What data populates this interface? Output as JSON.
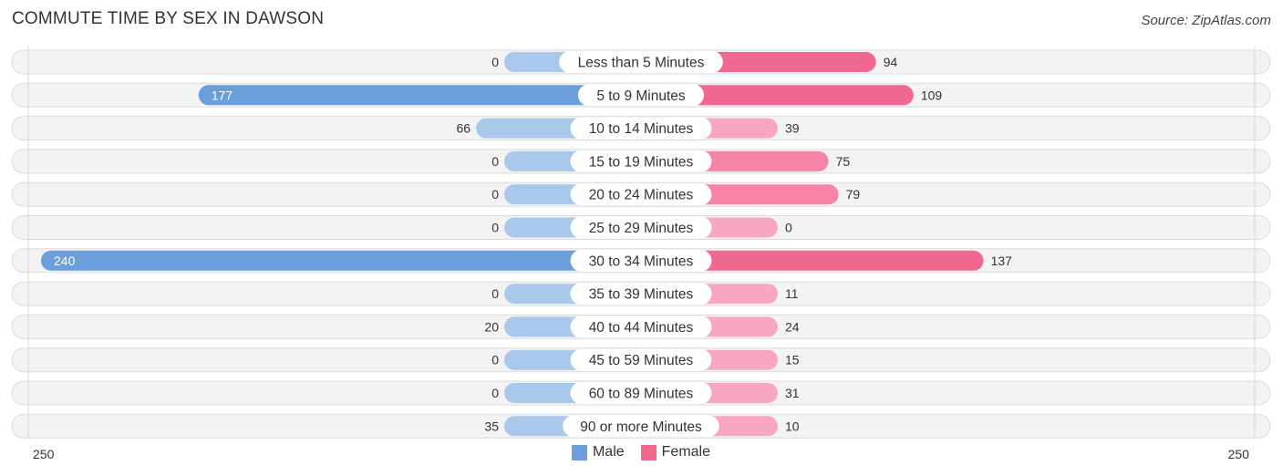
{
  "header": {
    "title": "COMMUTE TIME BY SEX IN DAWSON",
    "source": "Source: ZipAtlas.com"
  },
  "colors": {
    "male": "#6a9fdc",
    "male_light": "#a9c8eb",
    "female": "#f06890",
    "female_light": "#f7a8c0"
  },
  "chart_data": {
    "type": "bar",
    "orientation": "horizontal-diverging",
    "title": "COMMUTE TIME BY SEX IN DAWSON",
    "categories": [
      "Less than 5 Minutes",
      "5 to 9 Minutes",
      "10 to 14 Minutes",
      "15 to 19 Minutes",
      "20 to 24 Minutes",
      "25 to 29 Minutes",
      "30 to 34 Minutes",
      "35 to 39 Minutes",
      "40 to 44 Minutes",
      "45 to 59 Minutes",
      "60 to 89 Minutes",
      "90 or more Minutes"
    ],
    "series": [
      {
        "name": "Male",
        "values": [
          0,
          177,
          66,
          0,
          0,
          0,
          240,
          0,
          20,
          0,
          0,
          35
        ]
      },
      {
        "name": "Female",
        "values": [
          94,
          109,
          39,
          75,
          79,
          0,
          137,
          11,
          24,
          15,
          31,
          10
        ]
      }
    ],
    "xlim": [
      -250,
      250
    ],
    "axis_labels": {
      "left": "250",
      "right": "250"
    },
    "legend": {
      "position": "bottom-center",
      "entries": [
        "Male",
        "Female"
      ]
    },
    "grid": false
  }
}
